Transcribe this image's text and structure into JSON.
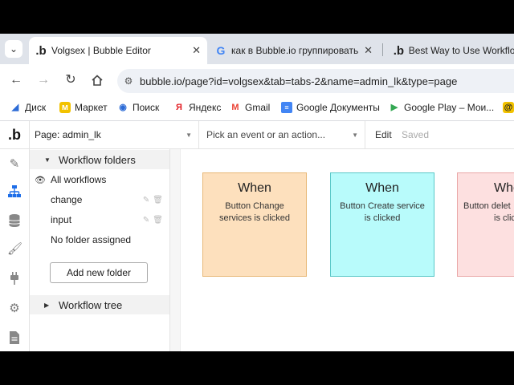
{
  "tabs": [
    {
      "icon": "bubble-logo-icon",
      "favicon": ".b",
      "title": "Volgsex | Bubble Editor",
      "close": "✕",
      "active": true
    },
    {
      "icon": "google-icon",
      "favicon": "G",
      "title": "как в Bubble.io группировать ",
      "close": "✕",
      "active": false
    },
    {
      "icon": "bubble-logo-icon",
      "favicon": ".b",
      "title": "Best Way to Use Workflow",
      "close": "",
      "active": false
    }
  ],
  "address_bar": {
    "url": "bubble.io/page?id=volgsex&tab=tabs-2&name=admin_lk&type=page"
  },
  "bookmarks": [
    {
      "label": "Диск",
      "icon": "disk-icon",
      "color": "#2c6bd6"
    },
    {
      "label": "Маркет",
      "icon": "market-icon",
      "color": "#f2c200"
    },
    {
      "label": "Поиск",
      "icon": "search-globe-icon",
      "color": "#2c6bd6"
    },
    {
      "label": "Яндекс",
      "icon": "yandex-icon",
      "color": "#e31e24"
    },
    {
      "label": "Gmail",
      "icon": "gmail-icon",
      "color": "#ea4335"
    },
    {
      "label": "Google Документы",
      "icon": "docs-icon",
      "color": "#4285f4"
    },
    {
      "label": "Google Play – Мои...",
      "icon": "play-icon",
      "color": "#34a853"
    }
  ],
  "editor": {
    "logo": ".b",
    "page_label": "Page: admin_lk",
    "event_placeholder": "Pick an event or an action...",
    "edit_label": "Edit",
    "saved_label": "Saved"
  },
  "rail_icons": [
    "design-icon",
    "workflow-icon",
    "data-icon",
    "styles-icon",
    "plugins-icon",
    "settings-icon",
    "logs-icon"
  ],
  "sidebar": {
    "folders_header": "Workflow folders",
    "all_workflows": "All workflows",
    "folders": [
      "change",
      "input"
    ],
    "no_folder": "No folder assigned",
    "add_folder_button": "Add new folder",
    "tree_header": "Workflow tree"
  },
  "workflows": [
    {
      "when": "When",
      "event": "Button Change services is clicked",
      "line1": "Button Change",
      "line2": "services is clicked",
      "bg": "#fde0bd",
      "border": "#e8b877"
    },
    {
      "when": "When",
      "event": "Button Create service is clicked",
      "line1": "Button Create service",
      "line2": "is clicked",
      "bg": "#b8fbfb",
      "border": "#5ac8c8"
    },
    {
      "when": "When",
      "event": "Button delete ... is clicked",
      "line1": "Button delet",
      "line2": "is clic",
      "bg": "#fde0e0",
      "border": "#eaa8a8"
    }
  ]
}
